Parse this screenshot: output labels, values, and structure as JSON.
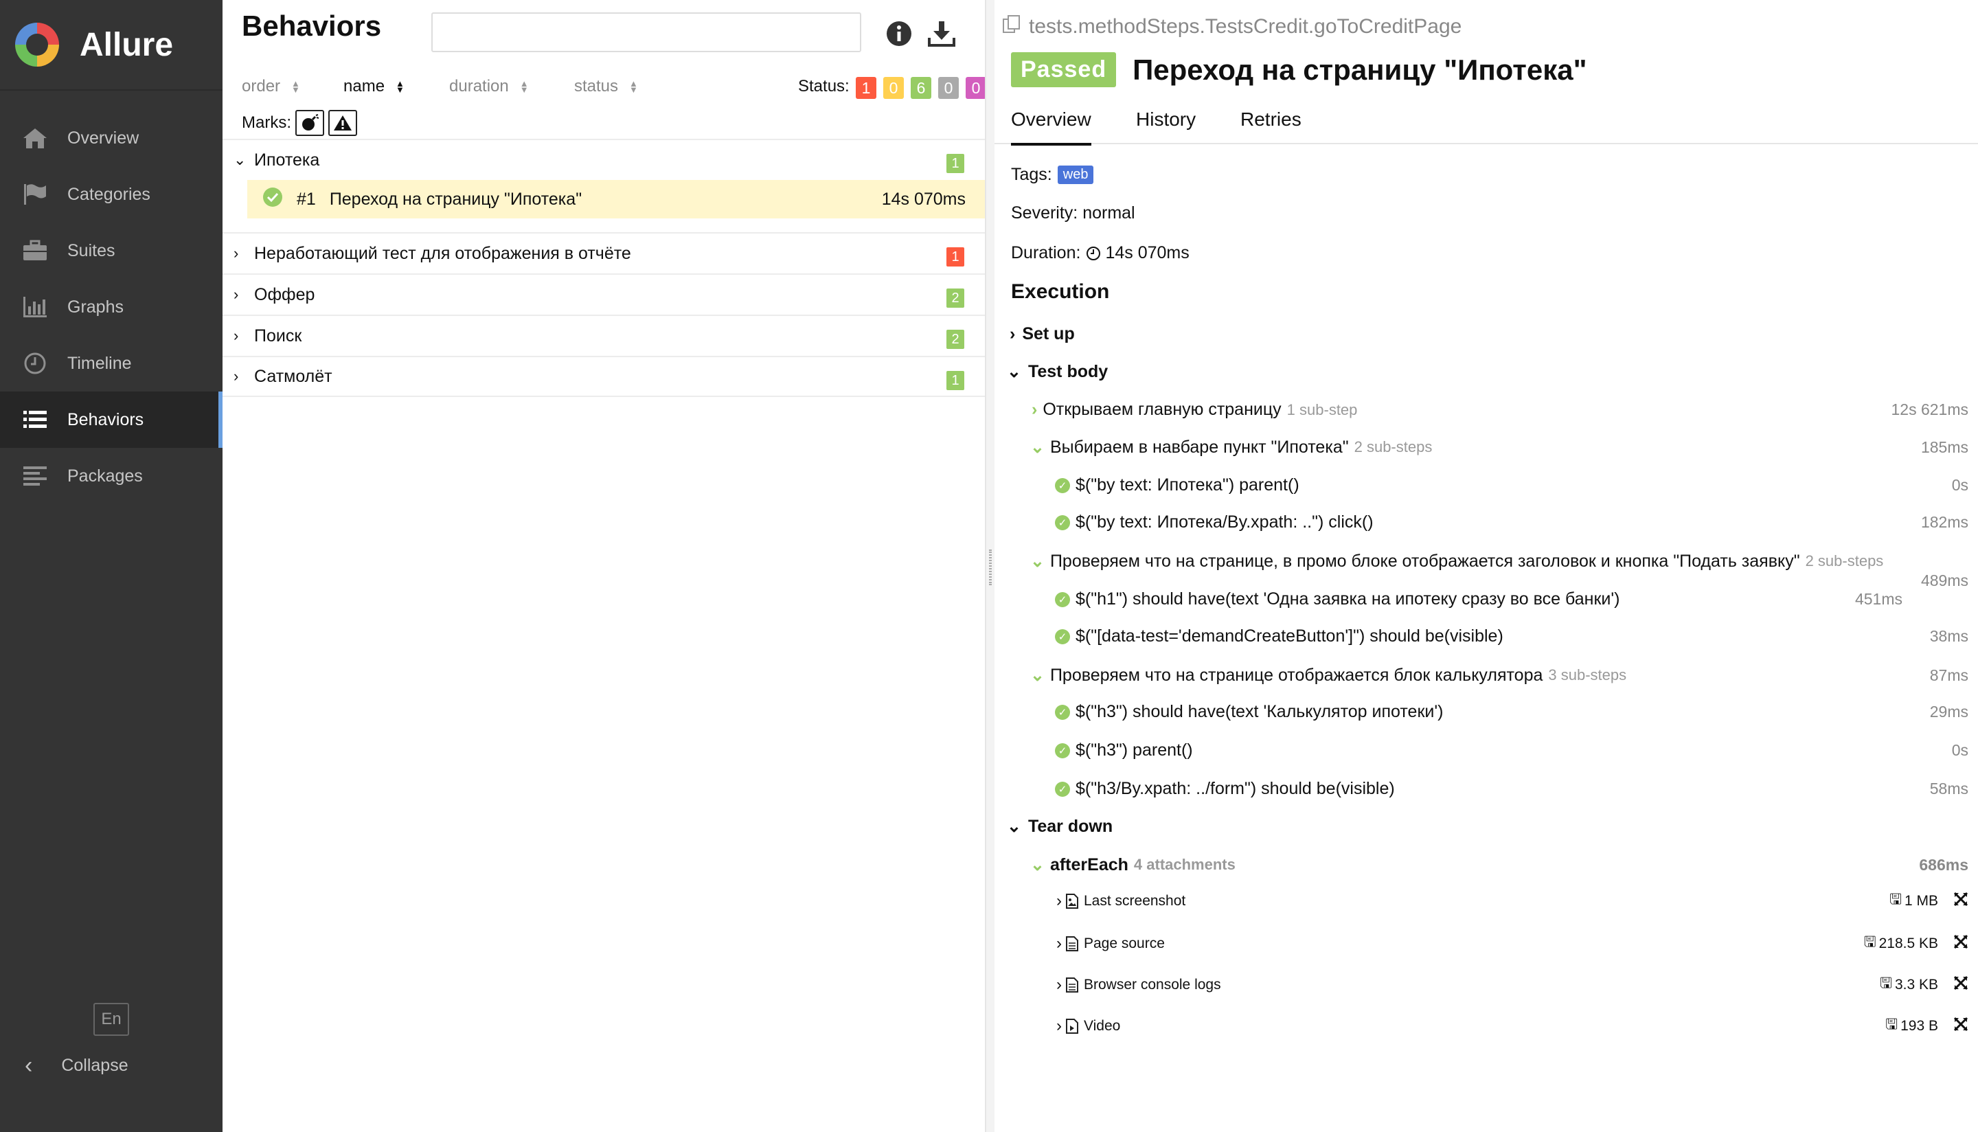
{
  "sidebar": {
    "brand": "Allure",
    "items": [
      {
        "label": "Overview",
        "icon": "home-icon"
      },
      {
        "label": "Categories",
        "icon": "flag-icon"
      },
      {
        "label": "Suites",
        "icon": "briefcase-icon"
      },
      {
        "label": "Graphs",
        "icon": "bar-chart-icon"
      },
      {
        "label": "Timeline",
        "icon": "clock-icon"
      },
      {
        "label": "Behaviors",
        "icon": "list-icon",
        "active": true
      },
      {
        "label": "Packages",
        "icon": "align-left-icon"
      }
    ],
    "language": "En",
    "collapse_label": "Collapse"
  },
  "behaviors": {
    "title": "Behaviors",
    "search": {
      "value": "",
      "placeholder": ""
    },
    "sort": [
      {
        "label": "order"
      },
      {
        "label": "name",
        "active": true
      },
      {
        "label": "duration"
      },
      {
        "label": "status"
      }
    ],
    "status_label": "Status:",
    "status_counts": [
      {
        "value": "1",
        "color": "#fd5a3e"
      },
      {
        "value": "0",
        "color": "#ffd050"
      },
      {
        "value": "6",
        "color": "#97cc64"
      },
      {
        "value": "0",
        "color": "#aaaaaa"
      },
      {
        "value": "0",
        "color": "#d35ebe"
      }
    ],
    "marks_label": "Marks:",
    "groups": [
      {
        "name": "Ипотека",
        "count": "1",
        "color": "#97cc64",
        "expanded": true,
        "cases": [
          {
            "num": "#1",
            "name": "Переход на страницу \"Ипотека\"",
            "duration": "14s 070ms"
          }
        ]
      },
      {
        "name": "Неработающий тест для отображения в отчёте",
        "count": "1",
        "color": "#fd5a3e"
      },
      {
        "name": "Оффер",
        "count": "2",
        "color": "#97cc64"
      },
      {
        "name": "Поиск",
        "count": "2",
        "color": "#97cc64"
      },
      {
        "name": "Сатмолёт",
        "count": "1",
        "color": "#97cc64"
      }
    ]
  },
  "test": {
    "path": "tests.methodSteps.TestsCredit.goToCreditPage",
    "status": "Passed",
    "title": "Переход на страницу \"Ипотека\"",
    "tabs": [
      "Overview",
      "History",
      "Retries"
    ],
    "tags_label": "Tags:",
    "tag": "web",
    "severity": "Severity: normal",
    "duration_label": "Duration:",
    "duration": "14s 070ms",
    "execution_label": "Execution",
    "setup_label": "Set up",
    "body_label": "Test body",
    "teardown_label": "Tear down",
    "steps": [
      {
        "name": "Открываем главную страницу",
        "meta": "1 sub-step",
        "duration": "12s 621ms"
      },
      {
        "name": "Выбираем в навбаре пункт \"Ипотека\"",
        "meta": "2 sub-steps",
        "duration": "185ms"
      },
      {
        "name": "$(\"by text: Ипотека\") parent()",
        "duration": "0s"
      },
      {
        "name": "$(\"by text: Ипотека/By.xpath: ..\") click()",
        "duration": "182ms"
      },
      {
        "name": "Проверяем что на странице, в промо блоке отображается заголовок и кнопка \"Подать заявку\"",
        "meta": "2 sub-steps",
        "duration": "489ms"
      },
      {
        "name": "$(\"h1\") should have(text 'Одна заявка на ипотеку сразу во все банки')",
        "duration": "451ms"
      },
      {
        "name": "$(\"[data-test='demandCreateButton']\") should be(visible)",
        "duration": "38ms"
      },
      {
        "name": "Проверяем что на странице отображается блок калькулятора",
        "meta": "3 sub-steps",
        "duration": "87ms"
      },
      {
        "name": "$(\"h3\") should have(text 'Калькулятор ипотеки')",
        "duration": "29ms"
      },
      {
        "name": "$(\"h3\") parent()",
        "duration": "0s"
      },
      {
        "name": "$(\"h3/By.xpath: ../form\") should be(visible)",
        "duration": "58ms"
      }
    ],
    "after_each": {
      "name": "afterEach",
      "meta": "4 attachments",
      "duration": "686ms"
    },
    "attachments": [
      {
        "name": "Last screenshot",
        "size": "1 MB"
      },
      {
        "name": "Page source",
        "size": "218.5 KB"
      },
      {
        "name": "Browser console logs",
        "size": "3.3 KB"
      },
      {
        "name": "Video",
        "size": "193 B"
      }
    ]
  }
}
